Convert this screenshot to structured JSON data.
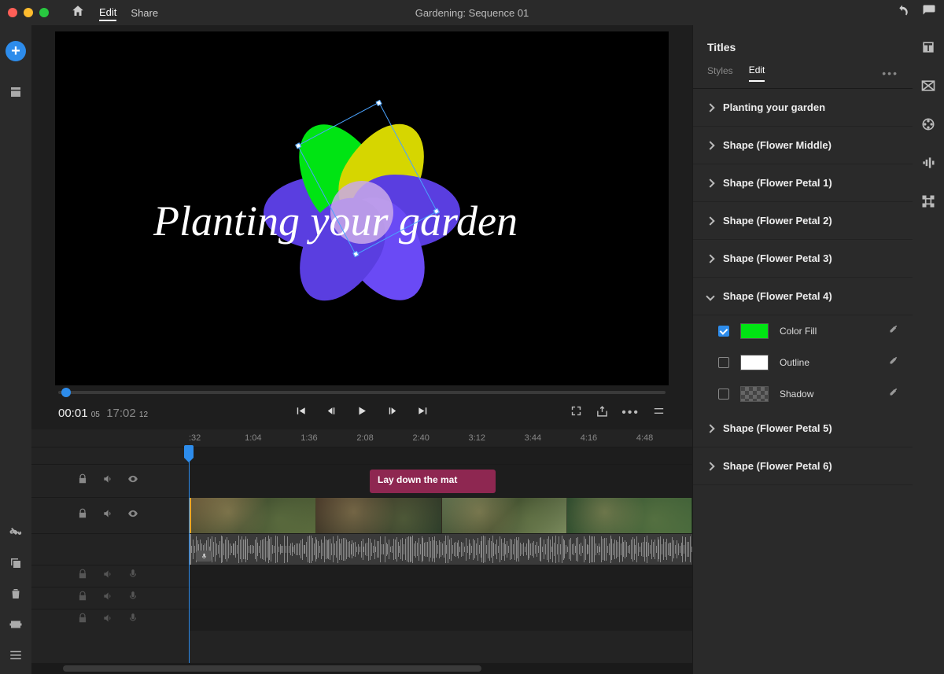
{
  "window_title": "Gardening: Sequence 01",
  "menu": {
    "edit": "Edit",
    "share": "Share"
  },
  "timecode": {
    "current": "00:01",
    "current_frames": "05",
    "duration": "17:02",
    "duration_frames": "12"
  },
  "overlay_title": "Planting your garden",
  "timeline_clip_label": "Lay down the mat",
  "time_marks": [
    ":32",
    "1:04",
    "1:36",
    "2:08",
    "2:40",
    "3:12",
    "3:44",
    "4:16",
    "4:48"
  ],
  "inspector": {
    "title": "Titles",
    "tabs": {
      "styles": "Styles",
      "edit": "Edit"
    },
    "layers": [
      "Planting your garden",
      "Shape (Flower Middle)",
      "Shape (Flower Petal 1)",
      "Shape (Flower Petal 2)",
      "Shape (Flower Petal 3)",
      "Shape (Flower Petal 4)",
      "Shape (Flower Petal 5)",
      "Shape (Flower Petal 6)"
    ],
    "active_layer_index": 5,
    "props": {
      "color_fill": {
        "label": "Color Fill",
        "on": true,
        "color": "#00e413"
      },
      "outline": {
        "label": "Outline",
        "on": false,
        "color": "#ffffff"
      },
      "shadow": {
        "label": "Shadow",
        "on": false,
        "color": "checker"
      }
    }
  },
  "petal_colors": [
    "#5a3ee0",
    "#00e413",
    "#d6d600",
    "#5a3ee0",
    "#6a4af5",
    "#5a3ee0"
  ],
  "petal_rotations": [
    -90,
    -30,
    30,
    90,
    150,
    210
  ]
}
